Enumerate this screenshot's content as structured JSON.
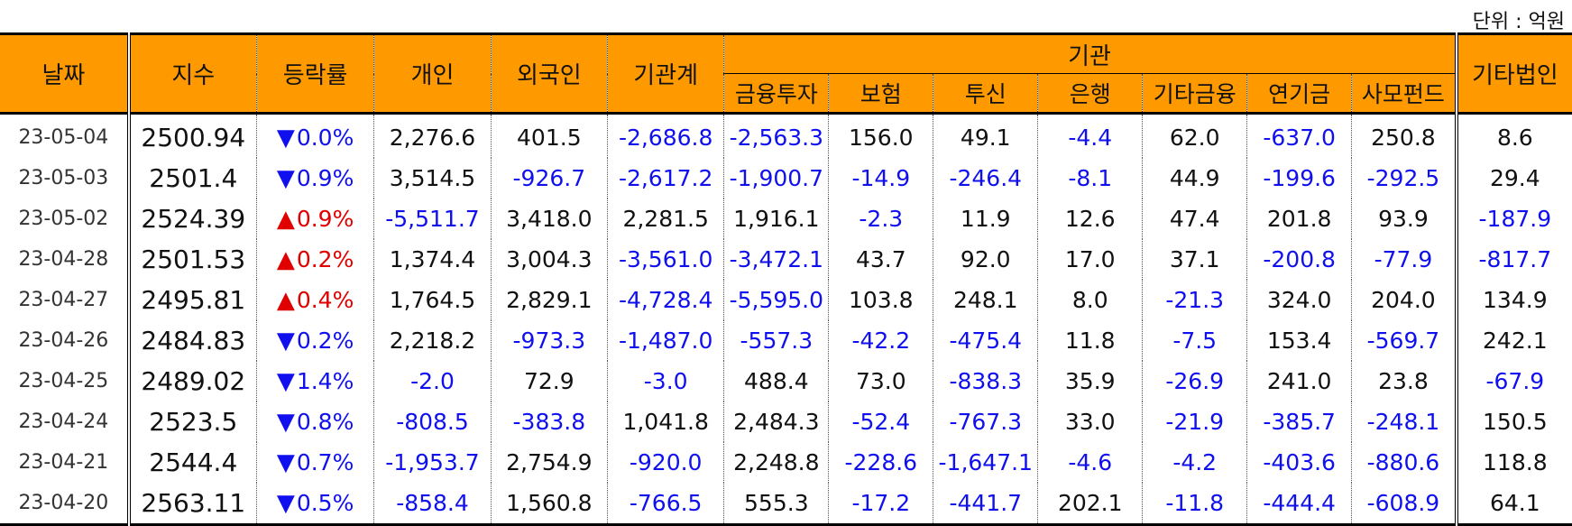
{
  "unit_label": "단위 : 억원",
  "colors": {
    "header_bg": "#FF9900",
    "negative": "#1010ee",
    "up": "#e00000",
    "down": "#1010ee"
  },
  "headers": {
    "date": "날짜",
    "index": "지수",
    "change": "등락률",
    "individual": "개인",
    "foreign": "외국인",
    "institution_total": "기관계",
    "institution_group": "기관",
    "sub": [
      "금융투자",
      "보험",
      "투신",
      "은행",
      "기타금융",
      "연기금",
      "사모펀드"
    ],
    "other_corp": "기타법인"
  },
  "rows": [
    {
      "date": "23-05-04",
      "index": "2500.94",
      "dir": "down",
      "arrow": "▼",
      "change": "0.0%",
      "individual": "2,276.6",
      "foreign": "401.5",
      "inst": "-2,686.8",
      "sub": [
        "-2,563.3",
        "156.0",
        "49.1",
        "-4.4",
        "62.0",
        "-637.0",
        "250.8"
      ],
      "other": "8.6"
    },
    {
      "date": "23-05-03",
      "index": "2501.4",
      "dir": "down",
      "arrow": "▼",
      "change": "0.9%",
      "individual": "3,514.5",
      "foreign": "-926.7",
      "inst": "-2,617.2",
      "sub": [
        "-1,900.7",
        "-14.9",
        "-246.4",
        "-8.1",
        "44.9",
        "-199.6",
        "-292.5"
      ],
      "other": "29.4"
    },
    {
      "date": "23-05-02",
      "index": "2524.39",
      "dir": "up",
      "arrow": "▲",
      "change": "0.9%",
      "individual": "-5,511.7",
      "foreign": "3,418.0",
      "inst": "2,281.5",
      "sub": [
        "1,916.1",
        "-2.3",
        "11.9",
        "12.6",
        "47.4",
        "201.8",
        "93.9"
      ],
      "other": "-187.9"
    },
    {
      "date": "23-04-28",
      "index": "2501.53",
      "dir": "up",
      "arrow": "▲",
      "change": "0.2%",
      "individual": "1,374.4",
      "foreign": "3,004.3",
      "inst": "-3,561.0",
      "sub": [
        "-3,472.1",
        "43.7",
        "92.0",
        "17.0",
        "37.1",
        "-200.8",
        "-77.9"
      ],
      "other": "-817.7"
    },
    {
      "date": "23-04-27",
      "index": "2495.81",
      "dir": "up",
      "arrow": "▲",
      "change": "0.4%",
      "individual": "1,764.5",
      "foreign": "2,829.1",
      "inst": "-4,728.4",
      "sub": [
        "-5,595.0",
        "103.8",
        "248.1",
        "8.0",
        "-21.3",
        "324.0",
        "204.0"
      ],
      "other": "134.9"
    },
    {
      "date": "23-04-26",
      "index": "2484.83",
      "dir": "down",
      "arrow": "▼",
      "change": "0.2%",
      "individual": "2,218.2",
      "foreign": "-973.3",
      "inst": "-1,487.0",
      "sub": [
        "-557.3",
        "-42.2",
        "-475.4",
        "11.8",
        "-7.5",
        "153.4",
        "-569.7"
      ],
      "other": "242.1"
    },
    {
      "date": "23-04-25",
      "index": "2489.02",
      "dir": "down",
      "arrow": "▼",
      "change": "1.4%",
      "individual": "-2.0",
      "foreign": "72.9",
      "inst": "-3.0",
      "sub": [
        "488.4",
        "73.0",
        "-838.3",
        "35.9",
        "-26.9",
        "241.0",
        "23.8"
      ],
      "other": "-67.9"
    },
    {
      "date": "23-04-24",
      "index": "2523.5",
      "dir": "down",
      "arrow": "▼",
      "change": "0.8%",
      "individual": "-808.5",
      "foreign": "-383.8",
      "inst": "1,041.8",
      "sub": [
        "2,484.3",
        "-52.4",
        "-767.3",
        "33.0",
        "-21.9",
        "-385.7",
        "-248.1"
      ],
      "other": "150.5"
    },
    {
      "date": "23-04-21",
      "index": "2544.4",
      "dir": "down",
      "arrow": "▼",
      "change": "0.7%",
      "individual": "-1,953.7",
      "foreign": "2,754.9",
      "inst": "-920.0",
      "sub": [
        "2,248.8",
        "-228.6",
        "-1,647.1",
        "-4.6",
        "-4.2",
        "-403.6",
        "-880.6"
      ],
      "other": "118.8"
    },
    {
      "date": "23-04-20",
      "index": "2563.11",
      "dir": "down",
      "arrow": "▼",
      "change": "0.5%",
      "individual": "-858.4",
      "foreign": "1,560.8",
      "inst": "-766.5",
      "sub": [
        "555.3",
        "-17.2",
        "-441.7",
        "202.1",
        "-11.8",
        "-444.4",
        "-608.9"
      ],
      "other": "64.1"
    }
  ]
}
